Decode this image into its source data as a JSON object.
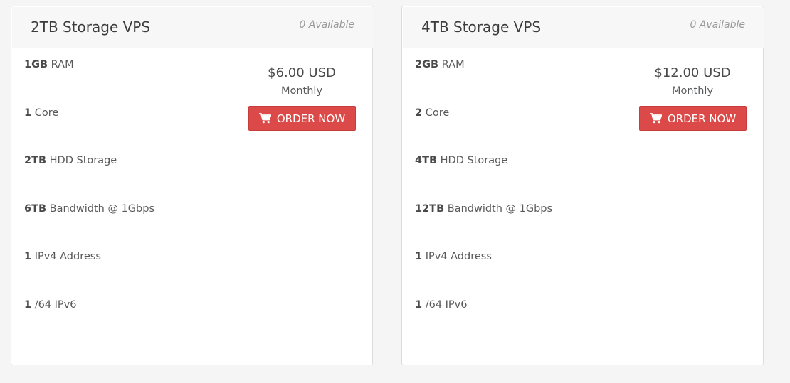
{
  "theme": {
    "accent": "#db4a48",
    "card_bg": "#ffffff",
    "header_bg": "#f7f7f7",
    "page_bg": "#f5f5f5"
  },
  "products": [
    {
      "title": "2TB Storage VPS",
      "availability": "0 Available",
      "features": [
        {
          "value": "1GB",
          "label": "RAM"
        },
        {
          "value": "1",
          "label": "Core"
        },
        {
          "value": "2TB",
          "label": "HDD Storage"
        },
        {
          "value": "6TB",
          "label": "Bandwidth @ 1Gbps"
        },
        {
          "value": "1",
          "label": "IPv4 Address"
        },
        {
          "value": "1",
          "label": "/64 IPv6"
        }
      ],
      "price": "$6.00 USD",
      "cycle": "Monthly",
      "button_label": "ORDER NOW",
      "button_icon": "shopping-cart-icon"
    },
    {
      "title": "4TB Storage VPS",
      "availability": "0 Available",
      "features": [
        {
          "value": "2GB",
          "label": "RAM"
        },
        {
          "value": "2",
          "label": "Core"
        },
        {
          "value": "4TB",
          "label": "HDD Storage"
        },
        {
          "value": "12TB",
          "label": "Bandwidth @ 1Gbps"
        },
        {
          "value": "1",
          "label": "IPv4 Address"
        },
        {
          "value": "1",
          "label": "/64 IPv6"
        }
      ],
      "price": "$12.00 USD",
      "cycle": "Monthly",
      "button_label": "ORDER NOW",
      "button_icon": "shopping-cart-icon"
    }
  ]
}
